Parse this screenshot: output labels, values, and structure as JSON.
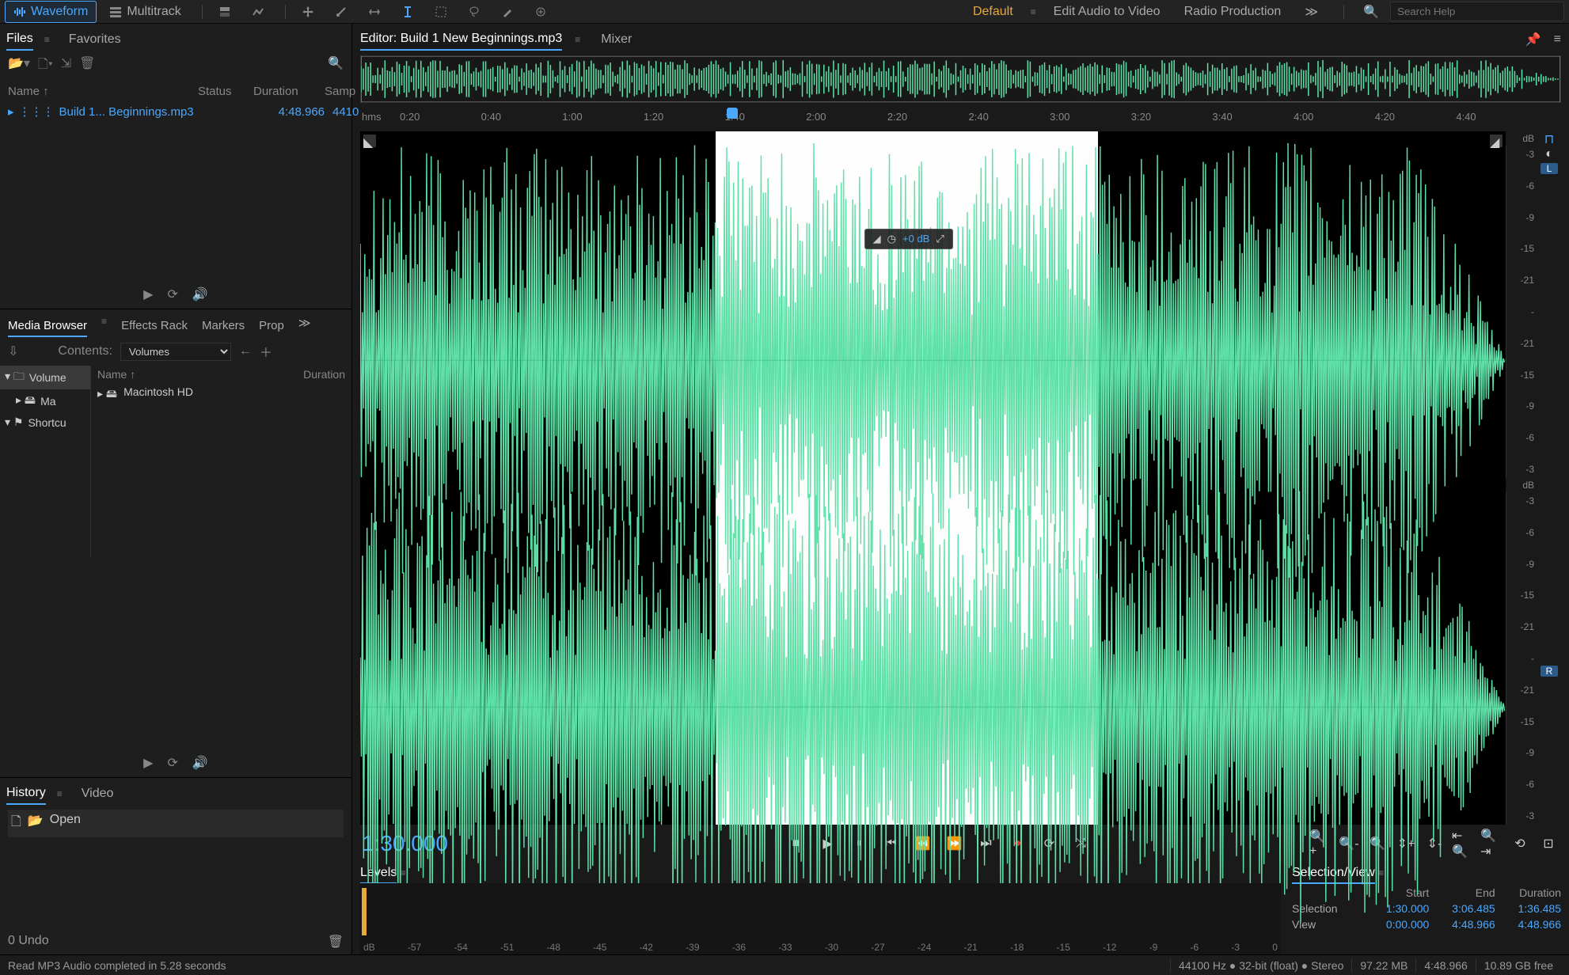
{
  "toolbar": {
    "waveform": "Waveform",
    "multitrack": "Multitrack",
    "workspace_default": "Default",
    "workspace_edit_av": "Edit Audio to Video",
    "workspace_radio": "Radio Production",
    "search_placeholder": "Search Help"
  },
  "files": {
    "tab_files": "Files",
    "tab_favorites": "Favorites",
    "cols": {
      "name": "Name ↑",
      "status": "Status",
      "duration": "Duration",
      "sample": "Samp"
    },
    "row": {
      "name": "Build 1... Beginnings.mp3",
      "duration": "4:48.966",
      "sample": "4410"
    }
  },
  "media": {
    "tab_browser": "Media Browser",
    "tab_effects": "Effects Rack",
    "tab_markers": "Markers",
    "tab_props": "Prop",
    "contents_label": "Contents:",
    "dropdown": "Volumes",
    "tree": {
      "volumes": "Volume",
      "ma": "Ma",
      "shortcuts": "Shortcu"
    },
    "list": {
      "name_hdr": "Name ↑",
      "dur_hdr": "Duration",
      "item": "Macintosh HD"
    }
  },
  "history": {
    "tab_history": "History",
    "tab_video": "Video",
    "open": "Open",
    "undo": "0 Undo"
  },
  "editor": {
    "tab_label": "Editor: Build 1 New Beginnings.mp3",
    "tab_mixer": "Mixer",
    "ruler_hms": "hms",
    "ticks": [
      "0:20",
      "0:40",
      "1:00",
      "1:20",
      "1:40",
      "2:00",
      "2:20",
      "2:40",
      "3:00",
      "3:20",
      "3:40",
      "4:00",
      "4:20",
      "4:40"
    ],
    "hud_db": "+0 dB",
    "db_label": "dB",
    "db_vals": [
      "-3",
      "-6",
      "-9",
      "-15",
      "-21",
      "-",
      "-21",
      "-15",
      "-9",
      "-6",
      "-3"
    ],
    "ch_L": "L",
    "ch_R": "R"
  },
  "transport": {
    "timecode": "1:30.000"
  },
  "levels": {
    "label": "Levels",
    "ticks": [
      "dB",
      "-57",
      "-54",
      "-51",
      "-48",
      "-45",
      "-42",
      "-39",
      "-36",
      "-33",
      "-30",
      "-27",
      "-24",
      "-21",
      "-18",
      "-15",
      "-12",
      "-9",
      "-6",
      "-3",
      "0"
    ]
  },
  "selview": {
    "label": "Selection/View",
    "cols": {
      "start": "Start",
      "end": "End",
      "duration": "Duration"
    },
    "selection_label": "Selection",
    "view_label": "View",
    "selection": {
      "start": "1:30.000",
      "end": "3:06.485",
      "dur": "1:36.485"
    },
    "view": {
      "start": "0:00.000",
      "end": "4:48.966",
      "dur": "4:48.966"
    }
  },
  "status": {
    "left": "Read MP3 Audio completed in 5.28 seconds",
    "format": "44100 Hz ● 32-bit (float) ● Stereo",
    "size": "97.22 MB",
    "dur": "4:48.966",
    "free": "10.89 GB free"
  },
  "colors": {
    "accent": "#4aa8ff",
    "wave": "#5fe0a8"
  }
}
